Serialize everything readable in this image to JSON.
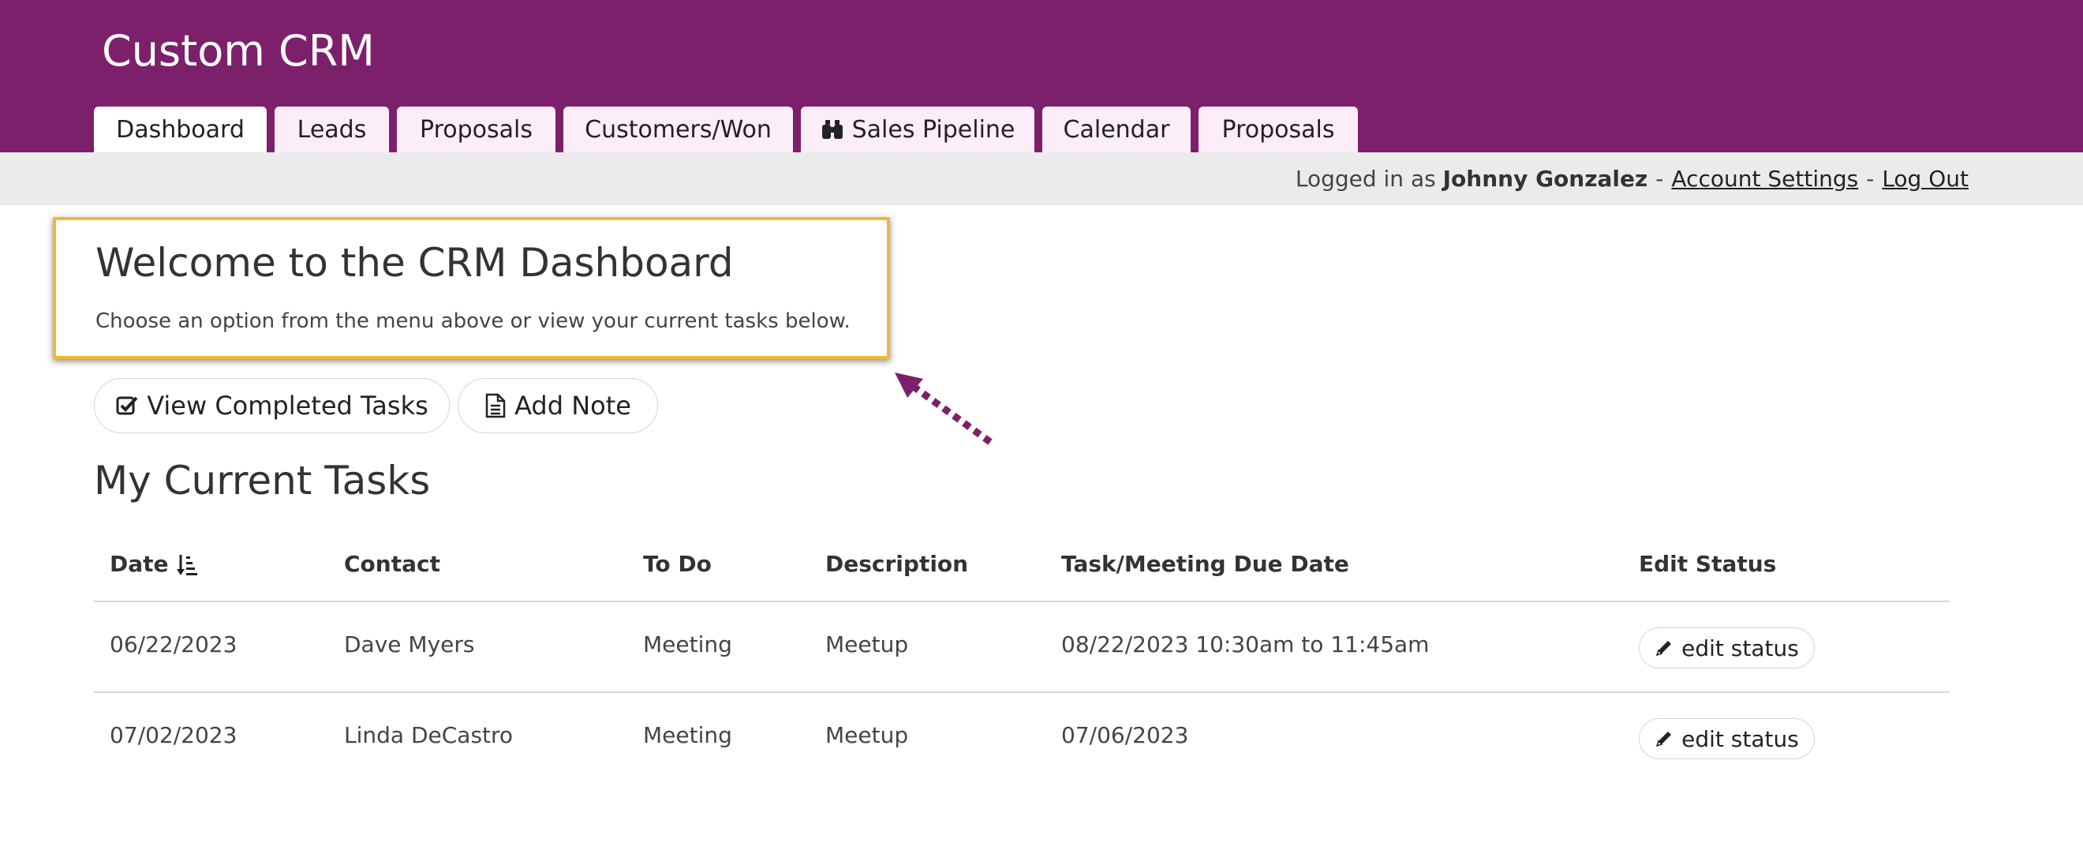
{
  "app": {
    "title": "Custom CRM",
    "brand_color": "#7d206b",
    "highlight_color": "#f0b836"
  },
  "tabs": [
    {
      "label": "Dashboard",
      "active": true
    },
    {
      "label": "Leads",
      "active": false
    },
    {
      "label": "Proposals",
      "active": false
    },
    {
      "label": "Customers/Won",
      "active": false
    },
    {
      "label": "Sales Pipeline",
      "active": false,
      "icon": "binoculars-icon"
    },
    {
      "label": "Calendar",
      "active": false
    },
    {
      "label": "Proposals",
      "active": false
    }
  ],
  "userbar": {
    "prefix": "Logged in as",
    "user_name": "Johnny Gonzalez",
    "separator": "-",
    "account_settings": "Account Settings",
    "log_out": "Log Out"
  },
  "welcome": {
    "title": "Welcome to the CRM Dashboard",
    "text": "Choose an option from the menu above or view your current tasks below."
  },
  "actions": {
    "view_completed": {
      "label": "View Completed Tasks",
      "icon": "check-square-icon"
    },
    "add_note": {
      "label": "Add Note",
      "icon": "document-icon"
    }
  },
  "tasks": {
    "title": "My Current Tasks",
    "columns": [
      "Date",
      "Contact",
      "To Do",
      "Description",
      "Task/Meeting Due Date",
      "Edit Status"
    ],
    "sort_icon": "sort-descending-icon",
    "rows": [
      {
        "date": "06/22/2023",
        "contact": "Dave Myers",
        "todo": "Meeting",
        "description": "Meetup",
        "due": "08/22/2023 10:30am to 11:45am",
        "action": "edit status"
      },
      {
        "date": "07/02/2023",
        "contact": "Linda DeCastro",
        "todo": "Meeting",
        "description": "Meetup",
        "due": "07/06/2023",
        "action": "edit status"
      }
    ]
  }
}
